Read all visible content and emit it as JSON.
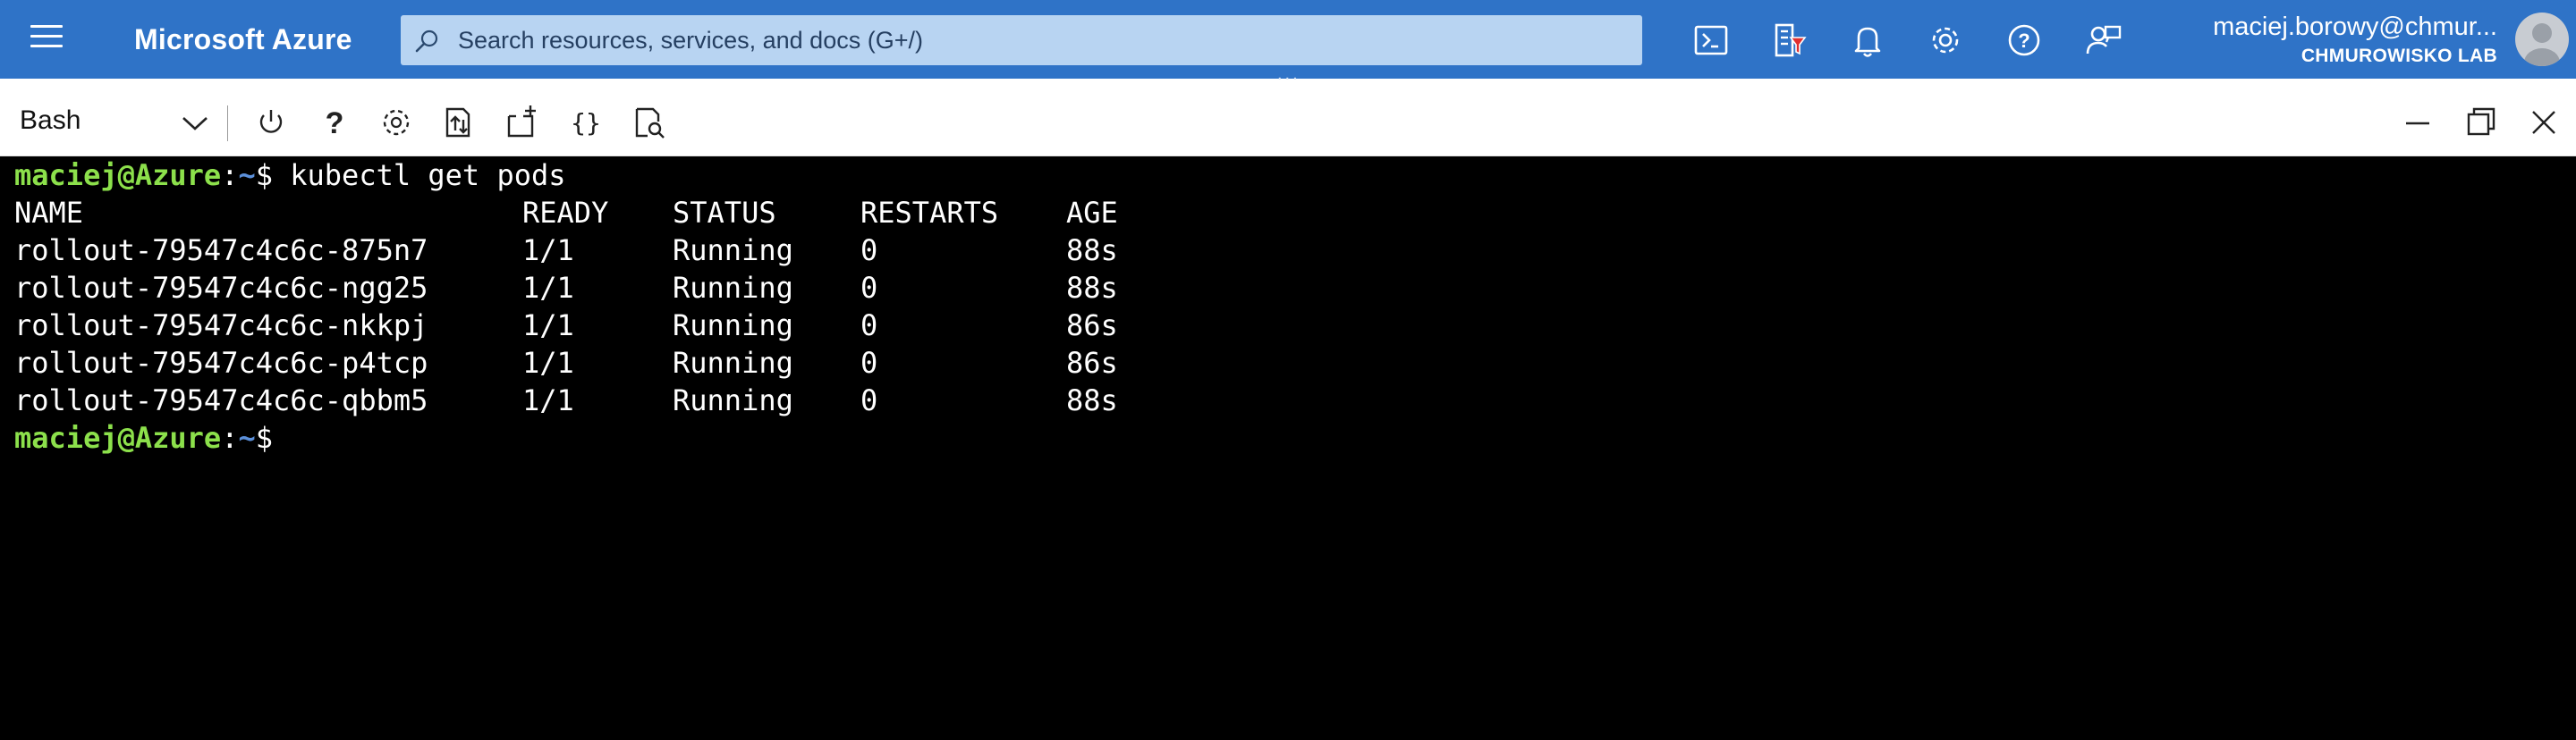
{
  "header": {
    "brand": "Microsoft Azure",
    "search_placeholder": "Search resources, services, and docs (G+/)",
    "user_email": "maciej.borowy@chmur...",
    "user_org": "CHMUROWISKO LAB",
    "resize_handle": "..."
  },
  "toolbar": {
    "shell": "Bash"
  },
  "terminal": {
    "prompt_user": "maciej@Azure",
    "prompt_sep": ":",
    "prompt_path": "~",
    "prompt_symbol": "$",
    "command": " kubectl get pods",
    "headers": [
      "NAME",
      "READY",
      "STATUS",
      "RESTARTS",
      "AGE"
    ],
    "rows": [
      [
        "rollout-79547c4c6c-875n7",
        "1/1",
        "Running",
        "0",
        "88s"
      ],
      [
        "rollout-79547c4c6c-ngg25",
        "1/1",
        "Running",
        "0",
        "88s"
      ],
      [
        "rollout-79547c4c6c-nkkpj",
        "1/1",
        "Running",
        "0",
        "86s"
      ],
      [
        "rollout-79547c4c6c-p4tcp",
        "1/1",
        "Running",
        "0",
        "86s"
      ],
      [
        "rollout-79547c4c6c-qbbm5",
        "1/1",
        "Running",
        "0",
        "88s"
      ]
    ]
  }
}
